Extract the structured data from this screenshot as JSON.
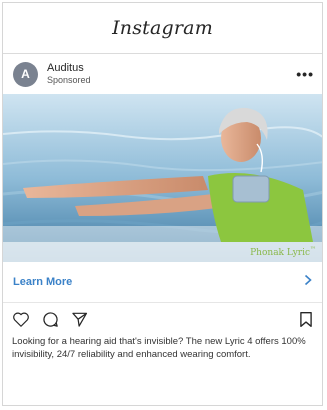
{
  "app": {
    "title": "Instagram"
  },
  "post": {
    "account": "Auditus",
    "avatar_letter": "A",
    "label": "Sponsored",
    "more_icon": "more-dots-icon",
    "brand_overlay": "Phonak Lyric",
    "brand_overlay_mark": "™",
    "cta_label": "Learn More",
    "caption": "Looking for a hearing aid that's invisible? The new Lyric 4 offers 100% invisibility, 24/7 reliability and enhanced wearing comfort."
  },
  "actions": {
    "icons": [
      "heart-icon",
      "comment-icon",
      "share-icon",
      "bookmark-icon"
    ]
  },
  "colors": {
    "cta": "#3b82c8",
    "brand_overlay": "#8ab84a",
    "shirt": "#8cc63f",
    "avatar": "#7a8290"
  }
}
